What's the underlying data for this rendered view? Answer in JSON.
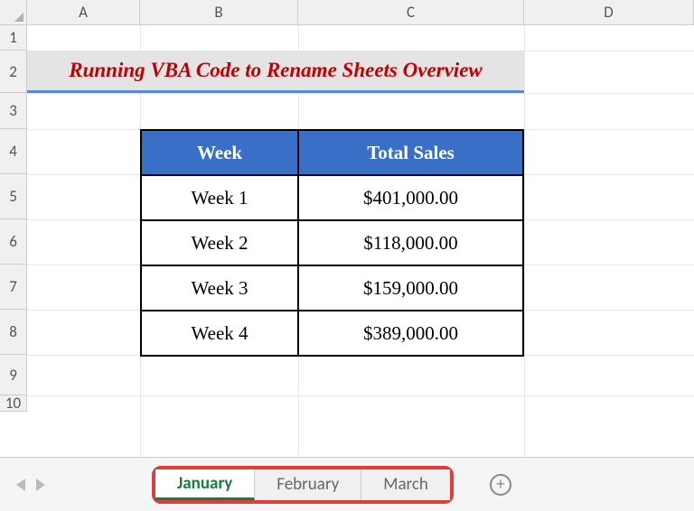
{
  "columns": [
    "A",
    "B",
    "C",
    "D"
  ],
  "rows": [
    "1",
    "2",
    "3",
    "4",
    "5",
    "6",
    "7",
    "8",
    "9",
    "10"
  ],
  "title": "Running VBA Code to Rename Sheets Overview",
  "table": {
    "headers": {
      "week": "Week",
      "sales": "Total Sales"
    },
    "rows": [
      {
        "week": "Week 1",
        "sales": "$401,000.00"
      },
      {
        "week": "Week 2",
        "sales": "$118,000.00"
      },
      {
        "week": "Week 3",
        "sales": "$159,000.00"
      },
      {
        "week": "Week 4",
        "sales": "$389,000.00"
      }
    ]
  },
  "tabs": {
    "items": [
      {
        "label": "January",
        "active": true
      },
      {
        "label": "February",
        "active": false
      },
      {
        "label": "March",
        "active": false
      }
    ],
    "add_icon": "+"
  },
  "chart_data": {
    "type": "table",
    "title": "Running VBA Code to Rename Sheets Overview",
    "columns": [
      "Week",
      "Total Sales"
    ],
    "rows": [
      [
        "Week 1",
        401000.0
      ],
      [
        "Week 2",
        118000.0
      ],
      [
        "Week 3",
        159000.0
      ],
      [
        "Week 4",
        389000.0
      ]
    ]
  }
}
